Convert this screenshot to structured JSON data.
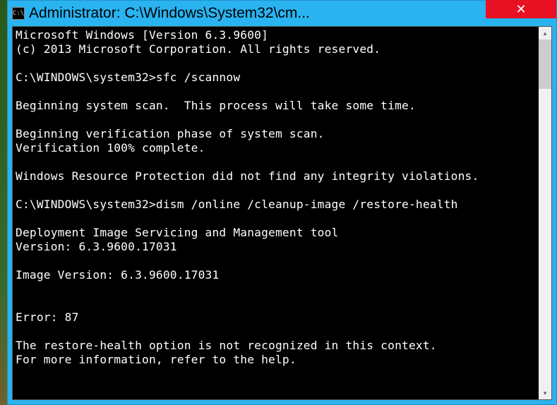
{
  "window": {
    "title": "Administrator: C:\\Windows\\System32\\cm..."
  },
  "console": {
    "lines": [
      "Microsoft Windows [Version 6.3.9600]",
      "(c) 2013 Microsoft Corporation. All rights reserved.",
      "",
      "C:\\WINDOWS\\system32>sfc /scannow",
      "",
      "Beginning system scan.  This process will take some time.",
      "",
      "Beginning verification phase of system scan.",
      "Verification 100% complete.",
      "",
      "Windows Resource Protection did not find any integrity violations.",
      "",
      "C:\\WINDOWS\\system32>dism /online /cleanup-image /restore-health",
      "",
      "Deployment Image Servicing and Management tool",
      "Version: 6.3.9600.17031",
      "",
      "Image Version: 6.3.9600.17031",
      "",
      "",
      "Error: 87",
      "",
      "The restore-health option is not recognized in this context.",
      "For more information, refer to the help."
    ]
  },
  "icons": {
    "app": "C:\\",
    "close": "✕",
    "up": "▴",
    "down": "▾"
  }
}
